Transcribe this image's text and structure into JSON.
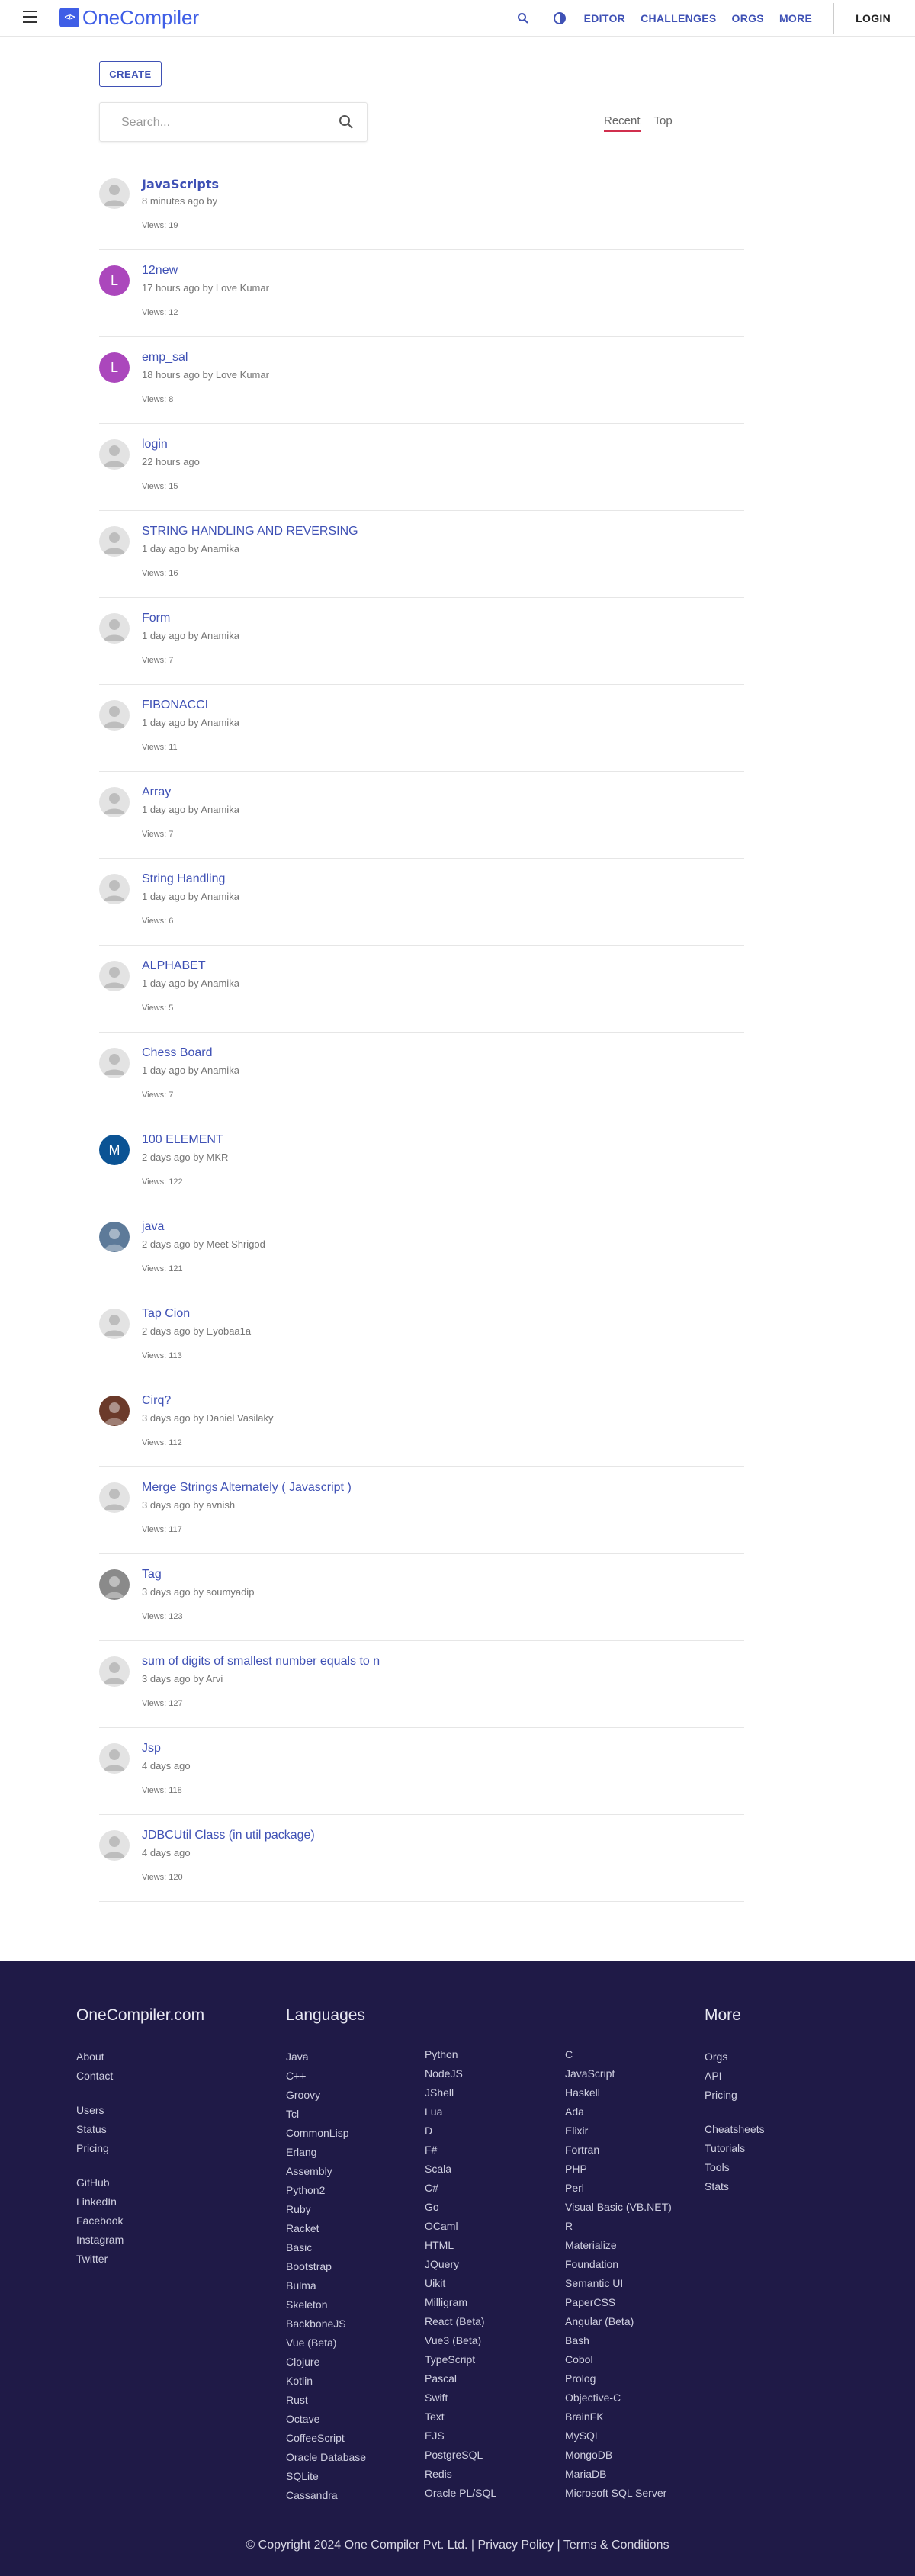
{
  "header": {
    "logo_mark": "</>",
    "logo_text": "OneCompiler",
    "nav": [
      "EDITOR",
      "CHALLENGES",
      "ORGS",
      "MORE"
    ],
    "login": "LOGIN",
    "icons": [
      "menu-icon",
      "search-icon",
      "theme-toggle-icon"
    ]
  },
  "main": {
    "create_label": "CREATE",
    "search_placeholder": "Search...",
    "tabs": [
      "Recent",
      "Top"
    ]
  },
  "items": [
    {
      "title": "𝗝𝗮𝘃𝗮𝗦𝗰𝗿𝗶𝗽𝘁𝘀",
      "meta": "8 minutes ago by",
      "views": "Views: 19",
      "avatar": "",
      "avatar_color": ""
    },
    {
      "title": "12new",
      "meta": "17 hours ago by Love Kumar",
      "views": "Views: 12",
      "avatar": "L",
      "avatar_color": "#ab47bc"
    },
    {
      "title": "emp_sal",
      "meta": "18 hours ago by Love Kumar",
      "views": "Views: 8",
      "avatar": "L",
      "avatar_color": "#ab47bc"
    },
    {
      "title": "login",
      "meta": "22 hours ago",
      "views": "Views: 15",
      "avatar": "",
      "avatar_color": ""
    },
    {
      "title": "STRING HANDLING AND REVERSING",
      "meta": "1 day ago by Anamika",
      "views": "Views: 16",
      "avatar": "",
      "avatar_color": ""
    },
    {
      "title": "Form",
      "meta": "1 day ago by Anamika",
      "views": "Views: 7",
      "avatar": "",
      "avatar_color": ""
    },
    {
      "title": "FIBONACCI",
      "meta": "1 day ago by Anamika",
      "views": "Views: 11",
      "avatar": "",
      "avatar_color": ""
    },
    {
      "title": "Array",
      "meta": "1 day ago by Anamika",
      "views": "Views: 7",
      "avatar": "",
      "avatar_color": ""
    },
    {
      "title": "String Handling",
      "meta": "1 day ago by Anamika",
      "views": "Views: 6",
      "avatar": "",
      "avatar_color": ""
    },
    {
      "title": "ALPHABET",
      "meta": "1 day ago by Anamika",
      "views": "Views: 5",
      "avatar": "",
      "avatar_color": ""
    },
    {
      "title": "Chess Board",
      "meta": "1 day ago by Anamika",
      "views": "Views: 7",
      "avatar": "",
      "avatar_color": ""
    },
    {
      "title": "100 ELEMENT",
      "meta": "2 days ago by MKR",
      "views": "Views: 122",
      "avatar": "M",
      "avatar_color": "#0b5394"
    },
    {
      "title": "java",
      "meta": "2 days ago by Meet Shrigod",
      "views": "Views: 121",
      "avatar": "photo",
      "avatar_color": "#5d7a99"
    },
    {
      "title": "Tap Cion",
      "meta": "2 days ago by Eyobaa1a",
      "views": "Views: 113",
      "avatar": "",
      "avatar_color": ""
    },
    {
      "title": "Cirq?",
      "meta": "3 days ago by Daniel Vasilaky",
      "views": "Views: 112",
      "avatar": "photo",
      "avatar_color": "#6b3a2a"
    },
    {
      "title": "Merge Strings Alternately ( Javascript )",
      "meta": "3 days ago by avnish",
      "views": "Views: 117",
      "avatar": "",
      "avatar_color": ""
    },
    {
      "title": "Tag",
      "meta": "3 days ago by soumyadip",
      "views": "Views: 123",
      "avatar": "photo",
      "avatar_color": "#8a8a8a"
    },
    {
      "title": "sum of digits of smallest number equals to n",
      "meta": "3 days ago by Arvi",
      "views": "Views: 127",
      "avatar": "",
      "avatar_color": ""
    },
    {
      "title": "Jsp",
      "meta": "4 days ago",
      "views": "Views: 118",
      "avatar": "",
      "avatar_color": ""
    },
    {
      "title": "JDBCUtil Class (in util package)",
      "meta": "4 days ago",
      "views": "Views: 120",
      "avatar": "",
      "avatar_color": ""
    }
  ],
  "footer": {
    "col1": {
      "head": "OneCompiler.com",
      "groups": [
        [
          "About",
          "Contact"
        ],
        [
          "Users",
          "Status",
          "Pricing"
        ],
        [
          "GitHub",
          "LinkedIn",
          "Facebook",
          "Instagram",
          "Twitter"
        ]
      ]
    },
    "languages_head": "Languages",
    "lang_col1": [
      "Java",
      "C++",
      "Groovy",
      "Tcl",
      "CommonLisp",
      "Erlang",
      "Assembly",
      "Python2",
      "Ruby",
      "Racket",
      "Basic",
      "Bootstrap",
      "Bulma",
      "Skeleton",
      "BackboneJS",
      "Vue (Beta)",
      "Clojure",
      "Kotlin",
      "Rust",
      "Octave",
      "CoffeeScript",
      "Oracle Database",
      "SQLite",
      "Cassandra"
    ],
    "lang_col2": [
      "Python",
      "NodeJS",
      "JShell",
      "Lua",
      "D",
      "F#",
      "Scala",
      "C#",
      "Go",
      "OCaml",
      "HTML",
      "JQuery",
      "Uikit",
      "Milligram",
      "React (Beta)",
      "Vue3 (Beta)",
      "TypeScript",
      "Pascal",
      "Swift",
      "Text",
      "EJS",
      "PostgreSQL",
      "Redis",
      "Oracle PL/SQL"
    ],
    "lang_col3": [
      "C",
      "JavaScript",
      "Haskell",
      "Ada",
      "Elixir",
      "Fortran",
      "PHP",
      "Perl",
      "Visual Basic (VB.NET)",
      "R",
      "Materialize",
      "Foundation",
      "Semantic UI",
      "PaperCSS",
      "Angular (Beta)",
      "Bash",
      "Cobol",
      "Prolog",
      "Objective-C",
      "BrainFK",
      "MySQL",
      "MongoDB",
      "MariaDB",
      "Microsoft SQL Server"
    ],
    "more": {
      "head": "More",
      "groups": [
        [
          "Orgs",
          "API",
          "Pricing"
        ],
        [
          "Cheatsheets",
          "Tutorials",
          "Tools",
          "Stats"
        ]
      ]
    },
    "copyright": "© Copyright 2024 One Compiler Pvt. Ltd. | Privacy Policy | Terms & Conditions"
  }
}
